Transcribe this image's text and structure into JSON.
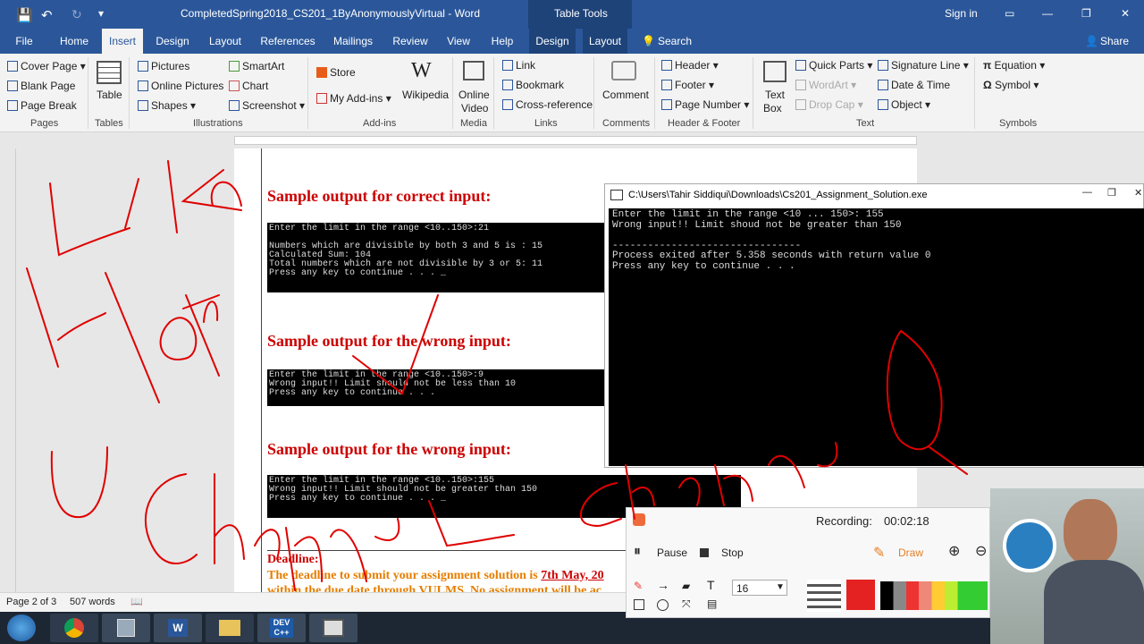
{
  "titlebar": {
    "doc_title": "CompletedSpring2018_CS201_1ByAnonymouslyVirtual - Word",
    "context": "Table Tools",
    "signin": "Sign in"
  },
  "tabs": [
    {
      "label": "File"
    },
    {
      "label": "Home"
    },
    {
      "label": "Insert"
    },
    {
      "label": "Design"
    },
    {
      "label": "Layout"
    },
    {
      "label": "References"
    },
    {
      "label": "Mailings"
    },
    {
      "label": "Review"
    },
    {
      "label": "View"
    },
    {
      "label": "Help"
    },
    {
      "label": "Design"
    },
    {
      "label": "Layout"
    }
  ],
  "tellme": "Search",
  "share": "Share",
  "ribbon": {
    "cover_page": "Cover Page",
    "blank_page": "Blank Page",
    "page_break": "Page Break",
    "g_pages": "Pages",
    "table": "Table",
    "g_tables": "Tables",
    "pictures": "Pictures",
    "online_pictures": "Online Pictures",
    "shapes": "Shapes",
    "smartart": "SmartArt",
    "chart": "Chart",
    "screenshot": "Screenshot",
    "g_illustrations": "Illustrations",
    "store": "Store",
    "my_addins": "My Add-ins",
    "wikipedia": "Wikipedia",
    "g_addins": "Add-ins",
    "online_video_1": "Online",
    "online_video_2": "Video",
    "g_media": "Media",
    "link": "Link",
    "bookmark": "Bookmark",
    "cross_reference": "Cross-reference",
    "g_links": "Links",
    "comment": "Comment",
    "g_comments": "Comments",
    "header": "Header",
    "footer": "Footer",
    "page_number": "Page Number",
    "g_header_footer": "Header & Footer",
    "text_box_1": "Text",
    "text_box_2": "Box",
    "quick_parts": "Quick Parts",
    "wordart": "WordArt",
    "drop_cap": "Drop Cap",
    "signature_line": "Signature Line",
    "date_time": "Date & Time",
    "object": "Object",
    "g_text": "Text",
    "equation": "Equation",
    "symbol": "Symbol",
    "g_symbols": "Symbols"
  },
  "doc": {
    "h1": "Sample output for correct input:",
    "out1": "Enter the limit in the range <10..150>:21\n\nNumbers which are divisible by both 3 and 5 is : 15\nCalculated Sum: 104\nTotal numbers which are not divisible by 3 or 5: 11\nPress any key to continue . . . _",
    "h2": "Sample output for the wrong input:",
    "out2": "Enter the limit in the range <10..150>:9\nWrong input!! Limit should not be less than 10\nPress any key to continue . . .",
    "h3": "Sample output for the wrong input:",
    "out3": "Enter the limit in the range <10..150>:155\nWrong input!! Limit should not be greater than 150\nPress any key to continue . . . _",
    "deadline": "Deadline:",
    "dl1a": "The deadline to submit your assignment solution is ",
    "dl1b": "7th May, 20",
    "dl2": "within the due date through VULMS. No assignment will be ac"
  },
  "console": {
    "title": "C:\\Users\\Tahir Siddiqui\\Downloads\\Cs201_Assignment_Solution.exe",
    "output": "Enter the limit in the range <10 ... 150>: 155\nWrong input!! Limit shoud not be greater than 150\n\n--------------------------------\nProcess exited after 5.358 seconds with return value 0\nPress any key to continue . . ."
  },
  "status": {
    "page": "Page 2 of 3",
    "words": "507 words"
  },
  "recorder": {
    "label": "Recording:",
    "time": "00:02:18",
    "pause": "Pause",
    "stop": "Stop",
    "draw": "Draw",
    "size": "16"
  },
  "ink_color": "#e00000"
}
